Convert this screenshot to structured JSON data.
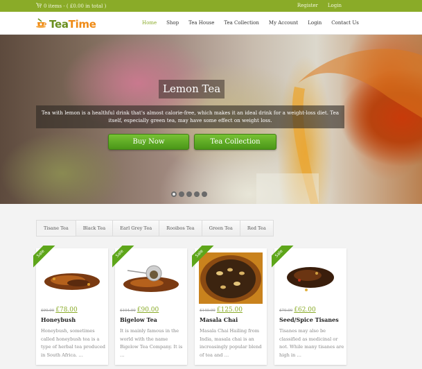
{
  "topbar": {
    "cart_icon": "cart-icon",
    "cart_text": "0 items - ( £0.00 in total )",
    "links": [
      "Register",
      "Login"
    ]
  },
  "header": {
    "logo_icon": "teapot-icon",
    "logo_word_1": "Tea",
    "logo_word_2": "Time",
    "nav": [
      {
        "label": "Home",
        "active": true
      },
      {
        "label": "Shop",
        "active": false
      },
      {
        "label": "Tea House",
        "active": false
      },
      {
        "label": "Tea Collection",
        "active": false
      },
      {
        "label": "My Account",
        "active": false
      },
      {
        "label": "Login",
        "active": false
      },
      {
        "label": "Contact Us",
        "active": false
      }
    ]
  },
  "hero": {
    "title": "Lemon Tea",
    "description": "Tea with lemon is a healthful drink that's almost calorie-free, which makes it an ideal drink for a weight-loss diet. Tea itself, especially green tea, may have some effect on weight loss.",
    "buttons": [
      "Buy Now",
      "Tea Collection"
    ],
    "slides": 5,
    "active_slide": 1
  },
  "tabs": [
    {
      "label": "Tisane Tea",
      "active": true
    },
    {
      "label": "Black Tea",
      "active": false
    },
    {
      "label": "Earl Grey Tea",
      "active": false
    },
    {
      "label": "Rooibos Tea",
      "active": false
    },
    {
      "label": "Green Tea",
      "active": false
    },
    {
      "label": "Red Tea",
      "active": false
    }
  ],
  "products": [
    {
      "badge": "Sale",
      "old_price": "£90.00",
      "price": "£78.00",
      "name": "Honeybush",
      "excerpt": "Honeybush, sometimes called honeybush tea is a type of herbal tea produced in South Africa. …",
      "image": "loose-tea-leaves"
    },
    {
      "badge": "Sale",
      "old_price": "£104.00",
      "price": "£90.00",
      "name": "Bigelow Tea",
      "excerpt": "It is mainly famous in the world with the name Bigelow Tea Company. It is …",
      "image": "tea-with-infuser"
    },
    {
      "badge": "Sale",
      "old_price": "£140.00",
      "price": "£125.00",
      "name": "Masala Chai",
      "excerpt": "Masala Chai Hailing from India, masala chai is an increasingly popular blend of tea and …",
      "image": "masala-chai-bowl"
    },
    {
      "badge": "Sale",
      "old_price": "£70.00",
      "price": "£62.00",
      "name": "Seed/Spice Tisanes",
      "excerpt": "Tisanes may also be classified as medicinal or not. While many tisanes are high in …",
      "image": "spice-tisane"
    }
  ]
}
